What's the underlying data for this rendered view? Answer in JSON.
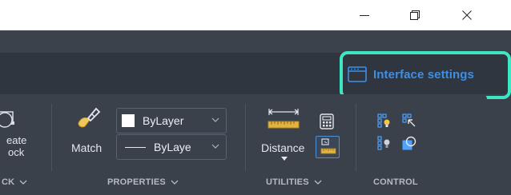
{
  "window": {
    "controls": [
      "minimize",
      "maximize",
      "close"
    ]
  },
  "header": {
    "interface_settings_label": "Interface settings",
    "accent_color": "#3d8fe6",
    "highlight_color": "#3ee6c4"
  },
  "ribbon": {
    "block": {
      "create_block_line1": "eate",
      "create_block_line2": "ock",
      "panel_label": "CK"
    },
    "properties": {
      "match_label": "Match",
      "color_value": "ByLayer",
      "linetype_value": "ByLaye",
      "panel_label": "PROPERTIES"
    },
    "utilities": {
      "distance_label": "Distance",
      "panel_label": "UTILITIES"
    },
    "control": {
      "panel_label": "CONTROL"
    }
  },
  "icons": {
    "title_bar": [
      "minimize-icon",
      "maximize-icon",
      "close-icon"
    ],
    "ribbon": [
      "create-block-icon",
      "match-properties-icon",
      "distance-icon",
      "calculator-icon",
      "measure-area-icon",
      "control-icon"
    ]
  }
}
